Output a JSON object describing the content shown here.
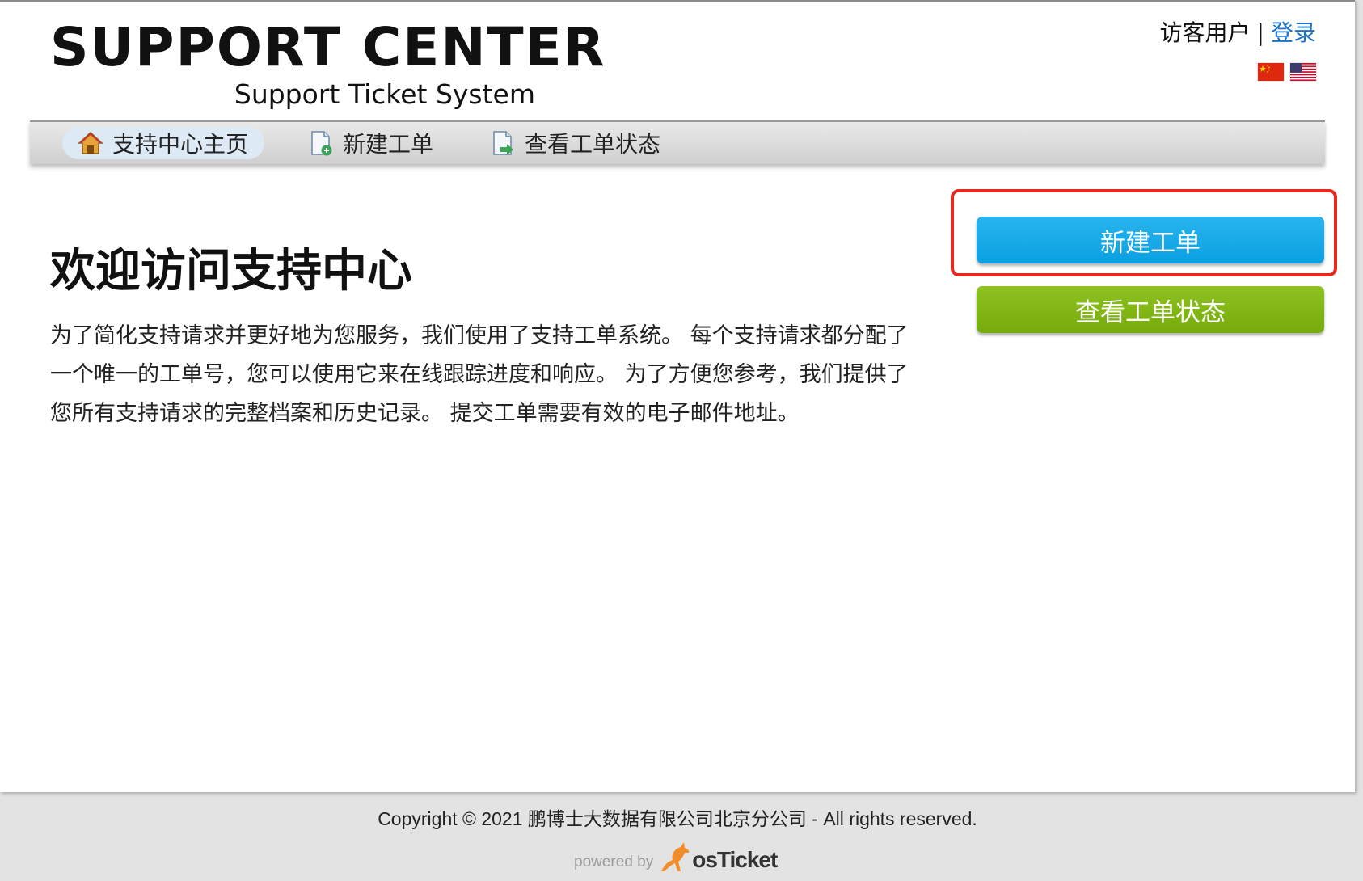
{
  "header": {
    "logo_title": "SUPPORT CENTER",
    "logo_subtitle": "Support Ticket System",
    "guest_user": "访客用户",
    "separator": "|",
    "login": "登录"
  },
  "nav": {
    "items": [
      {
        "label": "支持中心主页",
        "icon": "home-icon",
        "active": true
      },
      {
        "label": "新建工单",
        "icon": "new-ticket-icon",
        "active": false
      },
      {
        "label": "查看工单状态",
        "icon": "ticket-status-icon",
        "active": false
      }
    ]
  },
  "main": {
    "title": "欢迎访问支持中心",
    "text": "为了简化支持请求并更好地为您服务，我们使用了支持工单系统。 每个支持请求都分配了一个唯一的工单号，您可以使用它来在线跟踪进度和响应。 为了方便您参考，我们提供了您所有支持请求的完整档案和历史记录。 提交工单需要有效的电子邮件地址。"
  },
  "sidebar": {
    "new_ticket": "新建工单",
    "check_status": "查看工单状态"
  },
  "footer": {
    "copyright": "Copyright © 2021 鹏博士大数据有限公司北京分公司 - All rights reserved.",
    "powered_by": "powered by",
    "brand": "osTicket"
  },
  "colors": {
    "new_ticket_button": "#0aa0e2",
    "status_button": "#77ab0b",
    "link": "#1a73c8",
    "highlight": "#e8281e"
  }
}
